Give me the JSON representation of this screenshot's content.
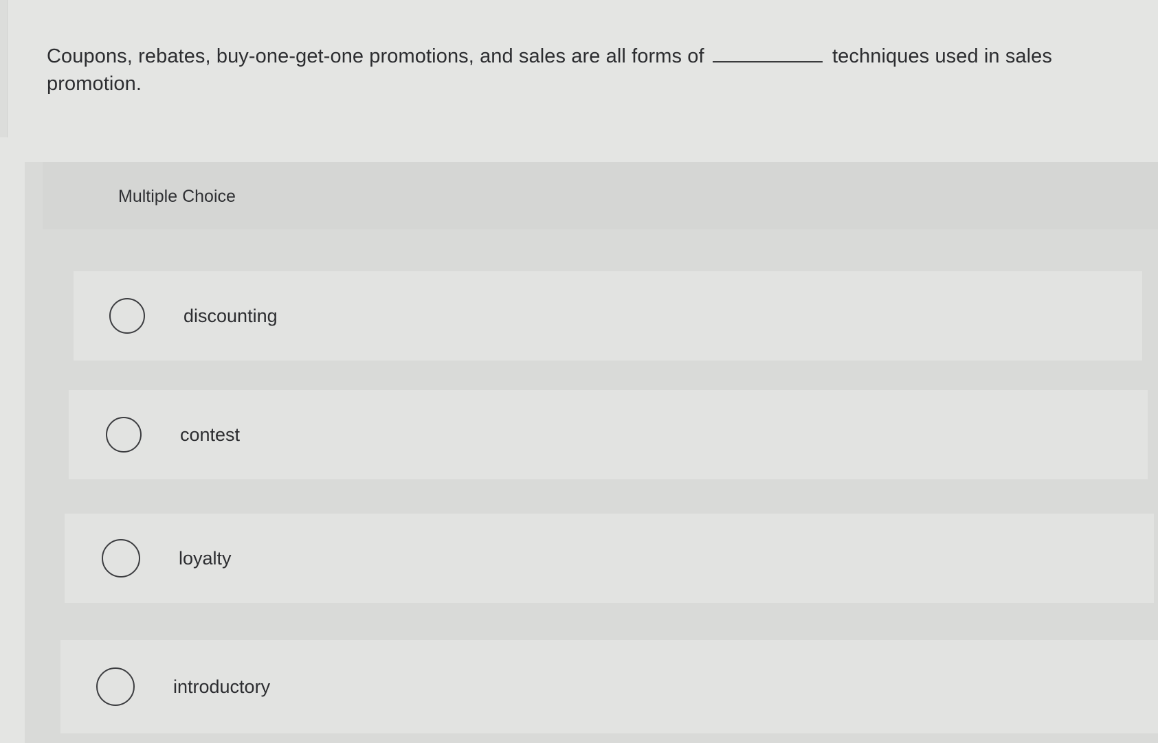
{
  "question": {
    "text_before": "Coupons, rebates, buy-one-get-one promotions, and sales are all forms of",
    "text_after": "techniques used in sales promotion."
  },
  "multiple_choice": {
    "title": "Multiple Choice",
    "options": [
      {
        "label": "discounting",
        "selected": false
      },
      {
        "label": "contest",
        "selected": false
      },
      {
        "label": "loyalty",
        "selected": false
      },
      {
        "label": "introductory",
        "selected": false
      }
    ]
  }
}
